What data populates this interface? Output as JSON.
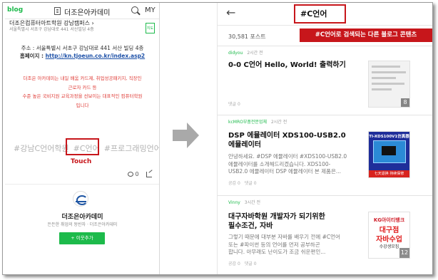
{
  "left": {
    "blog_logo": "blog",
    "header_title": "더조은아카데미",
    "my_label": "MY",
    "place": {
      "name": "더조은컴퓨터아트학원 강남캠퍼스 ›",
      "address": "서울특별시 서초구 강남대로 441 서산빌딩 4층",
      "map_label": "지도"
    },
    "address_line": "주소 : 서울특별시 서초구 강남대로 441 서산 빌딩 4층",
    "homepage_label": "홈페이지 : ",
    "homepage_url": "http://kn.tjoeun.co.kr/index.asp2",
    "promo": [
      "더조은 아카데미는 내일 배움 카드제, 취업성공패키지, 직장인",
      "근로자 카드 등",
      "수준 높은 국비지원 교육과정을 선보이는 대표적인 컴퓨터학원",
      "입니다"
    ],
    "tags": [
      "#강남C언어학원",
      "#C언어",
      "#프로그래밍언어"
    ],
    "touch_label": "Touch",
    "comment_count": "0",
    "blog_name": "더조은아카데미",
    "blog_desc": "든든한 취업의 동반자  ·  더조은아카데미",
    "add_neighbor": "+ 이웃추가"
  },
  "right": {
    "search_tag": "#C언어",
    "post_count": "30,581 포스트",
    "banner": "#C언어로 검색되는 다른 블로그 콘텐츠",
    "posts": [
      {
        "author": "didyou",
        "time": "2시간 전",
        "title_lines": [
          "0-0 C언어 Hello, World! 출력하기"
        ],
        "excerpt": [],
        "stats": [
          "댓글 0"
        ],
        "image_count": "8"
      },
      {
        "author": "kcMRO부품전문업체",
        "time": "2시간 전",
        "title_lines": [
          "DSP 에뮬레이터 XDS100-USB2.0",
          "에뮬레이터"
        ],
        "excerpt": [
          "안녕하세요. #DSP 에뮬레이터 #XDS100-USB2.0",
          "에뮬레이터를 소개해드리겠습니다. XDS100-",
          "USB2.0 에뮬레이터 DSP 에뮬레이터 본 제품은..."
        ],
        "stats": [
          "공감 0",
          "댓글 0"
        ],
        "thumb_caption": "TI-XDS100V1仿真器",
        "thumb_footer": "七天退换  持续保修"
      },
      {
        "author": "Vinny",
        "time": "3시간 전",
        "title_lines": [
          "대구자바학원 개발자가 되기위한",
          "필수조건, 자바"
        ],
        "excerpt": [
          "그렇기 때문에 대부분 자바를 배우기 전에 #C언어",
          "또는 #파이썬 등의 언어를 먼저 공부하곤",
          "합니다. 아무래도 난이도가 조금 쉬운편인..."
        ],
        "stats": [
          "공감 0",
          "댓글 0"
        ],
        "thumb_lines": [
          "KG아이티뱅크",
          "대구점",
          "자바수업",
          "수강생모집"
        ],
        "image_count": "12"
      }
    ]
  }
}
